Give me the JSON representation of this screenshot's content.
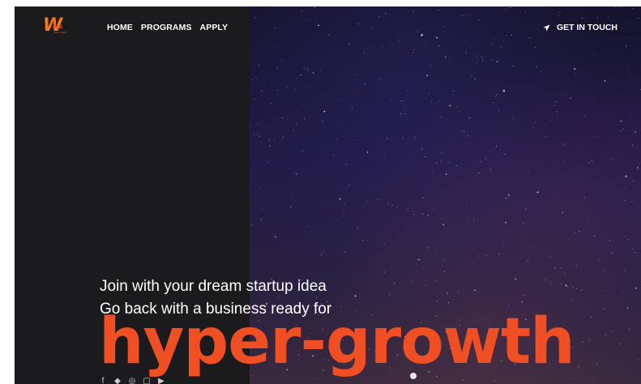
{
  "brand": {
    "logo_letter": "W",
    "logo_text": "ara",
    "logo_tagline": "VENTURES",
    "logo_color": "#f07a1a"
  },
  "nav": {
    "items": [
      {
        "label": "HOME"
      },
      {
        "label": "PROGRAMS"
      },
      {
        "label": "APPLY"
      }
    ],
    "cta_label": "GET IN TOUCH",
    "cta_icon": "paper-plane-icon"
  },
  "hero": {
    "line1": "Join with your dream startup idea",
    "line2": "Go back with a business ready for",
    "headline": "hyper-growth",
    "headline_color": "#f04e23",
    "background": "starry-night-sky"
  },
  "socials": {
    "icons": [
      "facebook-icon",
      "twitter-icon",
      "instagram-icon",
      "linkedin-icon",
      "youtube-icon"
    ]
  },
  "colors": {
    "left_panel": "#1b1b1d",
    "accent": "#f04e23"
  }
}
